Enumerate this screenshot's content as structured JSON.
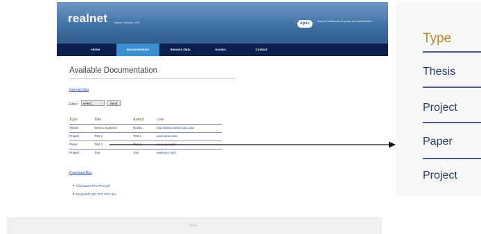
{
  "site": {
    "logo": "realnet",
    "logo_sub": "Sensor Network UPC",
    "badge": "epsc",
    "badge_text": "Escola Politècnica Superior de Castelldefels",
    "nav": [
      {
        "label": "Home",
        "active": false
      },
      {
        "label": "Documentation",
        "active": true
      },
      {
        "label": "Sensors Data",
        "active": false
      },
      {
        "label": "Access",
        "active": false
      },
      {
        "label": "Contact",
        "active": false
      }
    ],
    "page_title": "Available Documentation",
    "internet_links": "Internet links",
    "filter_label": "Filter:",
    "filter_value": "select...",
    "send_label": "Send",
    "table": {
      "headers": [
        "Type",
        "Title",
        "Author",
        "Link"
      ],
      "rows": [
        [
          "Thesis",
          "Sensor Systems",
          "Ruslia",
          "http://www.realnet.upc.edu/"
        ],
        [
          "Project",
          "Test 1",
          "Test 1",
          "www.epsc.edu/"
        ],
        [
          "Paper",
          "Test 2",
          "Test 2",
          "www.upc.edu/"
        ],
        [
          "Project",
          "Test",
          "Test",
          "www.upc.edu/"
        ]
      ]
    },
    "download_files": "Download files",
    "files": [
      "informacio TFC-PFC.pdf",
      "MAQUETA DE TFC-PFC.doc"
    ],
    "footer": "EPSC"
  },
  "zoom": {
    "header": "Type",
    "rows": [
      "Thesis",
      "Project",
      "Paper",
      "Project"
    ],
    "header_color": "#b58a2e",
    "row_color": "#243b63"
  }
}
